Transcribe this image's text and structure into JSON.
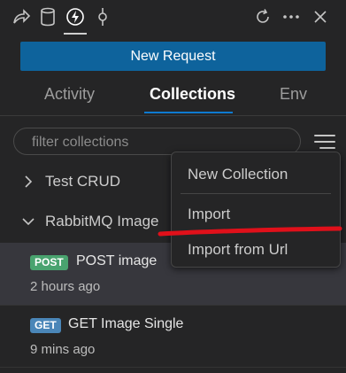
{
  "toolbar": {
    "icons": [
      "share-icon",
      "database-icon",
      "lightning-icon",
      "git-commit-icon",
      "refresh-icon",
      "more-icon",
      "close-icon"
    ],
    "active_icon": "lightning-icon"
  },
  "primary_button": {
    "label": "New Request"
  },
  "tabs": [
    {
      "label": "Activity",
      "active": false
    },
    {
      "label": "Collections",
      "active": true
    },
    {
      "label": "Env",
      "active": false
    }
  ],
  "filter": {
    "placeholder": "filter collections",
    "value": ""
  },
  "collections": [
    {
      "label": "Test CRUD",
      "expanded": false
    },
    {
      "label": "RabbitMQ Image",
      "expanded": true
    }
  ],
  "requests": [
    {
      "method": "POST",
      "name": "POST image",
      "time": "2 hours ago",
      "selected": true
    },
    {
      "method": "GET",
      "name": "GET Image Single",
      "time": "9 mins ago",
      "selected": false
    }
  ],
  "context_menu": {
    "items": [
      "New Collection",
      "Import",
      "Import from Url"
    ]
  },
  "colors": {
    "background": "#252526",
    "accent": "#0e639c",
    "tab_underline": "#0e7ad0",
    "post_badge": "#49a36f",
    "get_badge": "#4a86b8",
    "annotation": "#e0101a"
  }
}
